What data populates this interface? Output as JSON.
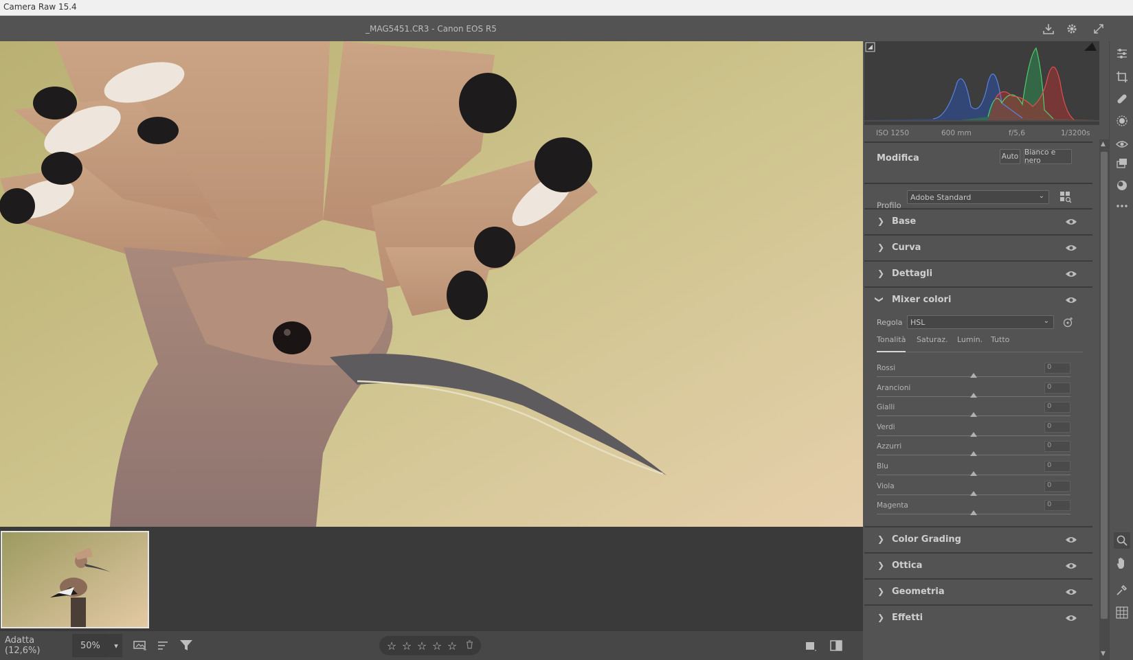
{
  "app": {
    "title": "Camera Raw 15.4"
  },
  "topbar": {
    "filename": "_MAG5451.CR3  -  Canon EOS R5"
  },
  "exif": {
    "iso": "ISO 1250",
    "focal": "600 mm",
    "aperture": "f/5,6",
    "shutter": "1/3200s"
  },
  "edit": {
    "title": "Modifica",
    "auto": "Auto",
    "bw": "Bianco e nero"
  },
  "profile": {
    "label": "Profilo",
    "value": "Adobe Standard"
  },
  "sections": {
    "base": "Base",
    "curve": "Curva",
    "details": "Dettagli",
    "mixer": "Mixer colori",
    "grading": "Color Grading",
    "optics": "Ottica",
    "geometry": "Geometria",
    "effects": "Effetti"
  },
  "mixer": {
    "adjust_label": "Regola",
    "adjust_value": "HSL",
    "tabs": [
      "Tonalità",
      "Saturaz.",
      "Lumin.",
      "Tutto"
    ],
    "sliders": [
      {
        "label": "Rossi",
        "value": "0"
      },
      {
        "label": "Arancioni",
        "value": "0"
      },
      {
        "label": "Gialli",
        "value": "0"
      },
      {
        "label": "Verdi",
        "value": "0"
      },
      {
        "label": "Azzurri",
        "value": "0"
      },
      {
        "label": "Blu",
        "value": "0"
      },
      {
        "label": "Viola",
        "value": "0"
      },
      {
        "label": "Magenta",
        "value": "0"
      }
    ]
  },
  "bottombar": {
    "fit": "Adatta (12,6%)",
    "zoom": "50%"
  },
  "icons": {
    "save": "download-icon",
    "settings": "gear-icon",
    "fullscreen": "expand-icon",
    "edit": "sliders-icon",
    "crop": "crop-icon",
    "heal": "bandage-icon",
    "mask": "mask-icon",
    "redeye": "eye-icon",
    "presets": "layers-icon",
    "snapshot": "snapshot-icon",
    "more": "ellipsis-icon",
    "zoom": "zoom-icon",
    "hand": "hand-icon",
    "sampler": "eyedropper-icon",
    "grid": "grid-icon"
  },
  "colors": {
    "panel": "#535353",
    "dark": "#3a3a3a",
    "text": "#c8c8c8"
  }
}
